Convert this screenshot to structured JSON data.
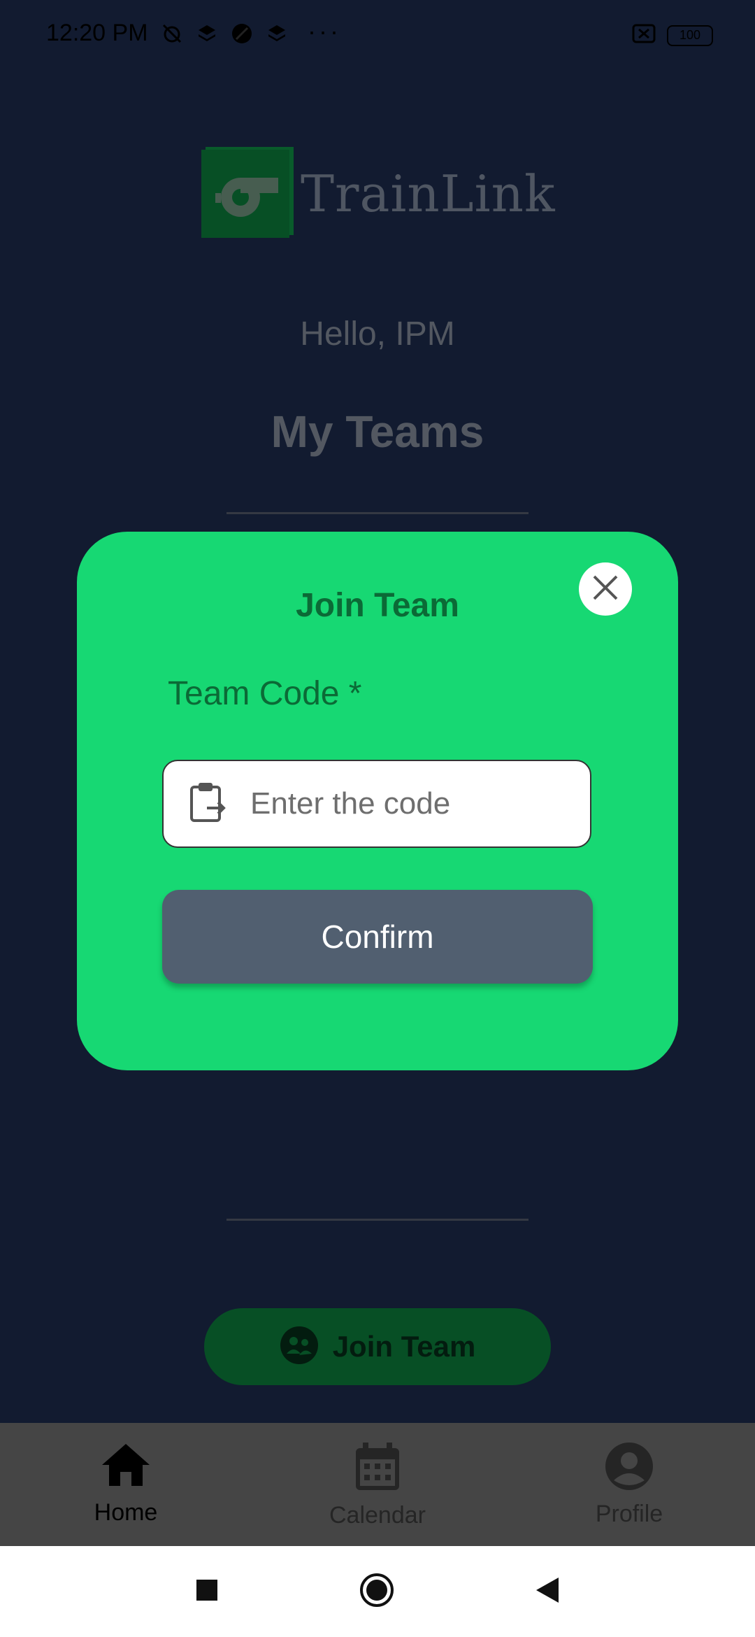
{
  "status_bar": {
    "time": "12:20 PM",
    "battery": "100"
  },
  "app": {
    "name": "TrainLink",
    "greeting": "Hello, IPM",
    "page_title": "My Teams"
  },
  "modal": {
    "title": "Join Team",
    "field_label": "Team Code *",
    "input_placeholder": "Enter the code",
    "input_value": "",
    "confirm_label": "Confirm"
  },
  "join_button": {
    "label": "Join Team"
  },
  "bottom_nav": {
    "items": [
      {
        "label": "Home",
        "icon": "home-icon",
        "active": true
      },
      {
        "label": "Calendar",
        "icon": "calendar-icon",
        "active": false
      },
      {
        "label": "Profile",
        "icon": "profile-icon",
        "active": false
      }
    ]
  },
  "colors": {
    "accent_green": "#17d873",
    "dark_green": "#0b7a3a",
    "background": "#1c2a4a",
    "confirm_button": "#515f70"
  }
}
